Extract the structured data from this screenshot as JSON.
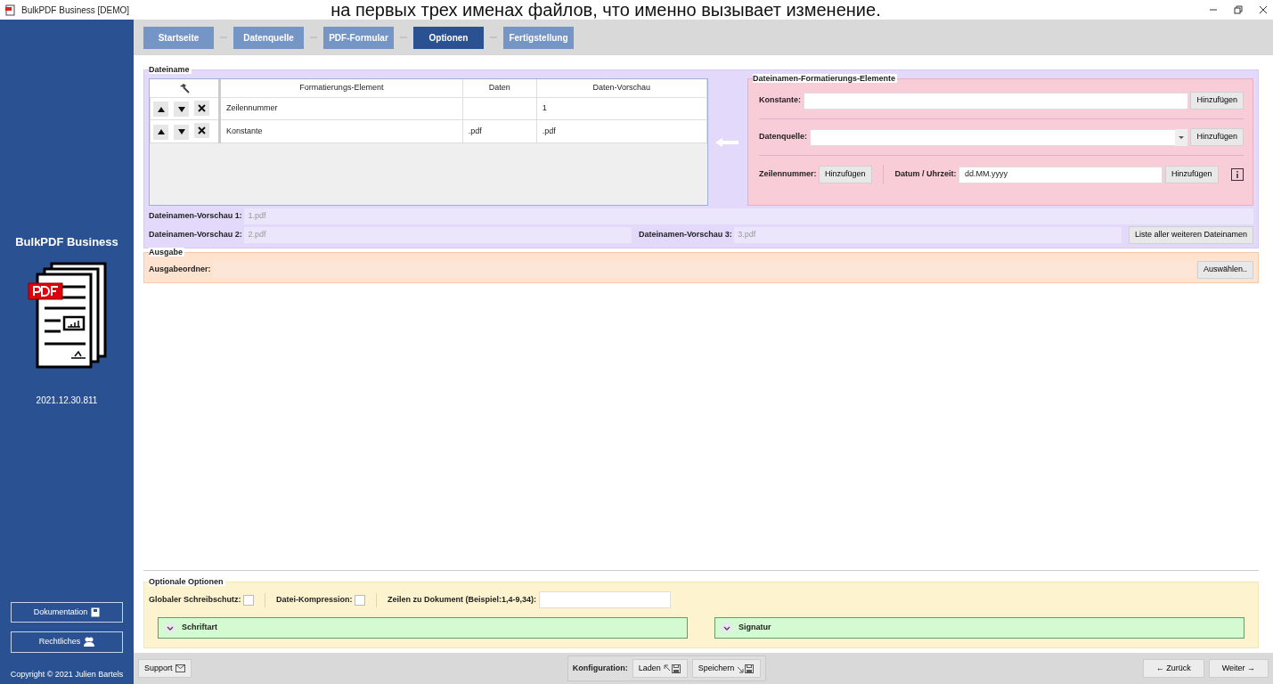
{
  "overlay_caption": "на первых трех именах файлов, что именно вызывает изменение.",
  "window": {
    "title": "BulkPDF Business [DEMO]"
  },
  "sidebar": {
    "app_name": "BulkPDF Business",
    "version": "2021.12.30.811",
    "buttons": [
      "Dokumentation",
      "Rechtliches"
    ],
    "copyright": "Copyright © 2021 Julien Bartels"
  },
  "steps": [
    {
      "label": "Startseite",
      "selected": false
    },
    {
      "label": "Datenquelle",
      "selected": false
    },
    {
      "label": "PDF-Formular",
      "selected": false
    },
    {
      "label": "Optionen",
      "selected": true
    },
    {
      "label": "Fertigstellung",
      "selected": false
    }
  ],
  "dateiname": {
    "title": "Dateiname",
    "table": {
      "columns": [
        "Formatierungs-Element",
        "Daten",
        "Daten-Vorschau"
      ],
      "rows": [
        [
          "Zeilennummer",
          "",
          "1"
        ],
        [
          "Konstante",
          ".pdf",
          ".pdf"
        ]
      ]
    },
    "elements": {
      "title": "Dateinamen-Formatierungs-Elemente",
      "konstante_label": "Konstante:",
      "datenquelle_label": "Datenquelle:",
      "zeilennummer_label": "Zeilennummer:",
      "datum_label": "Datum / Uhrzeit:",
      "datum_value": "dd.MM.yyyy",
      "konstante_button": "Hinzufügen",
      "datenquelle_button": "Hinzufügen",
      "zeilennummer_button": "Hinzufügen",
      "datum_button": "Hinzufügen"
    },
    "previews": [
      {
        "label": "Dateinamen-Vorschau 1:",
        "value": "1.pdf"
      },
      {
        "label": "Dateinamen-Vorschau 2:",
        "value": "2.pdf"
      },
      {
        "label": "Dateinamen-Vorschau 3:",
        "value": "3.pdf"
      }
    ],
    "list_button": "Liste aller weiteren Dateinamen"
  },
  "ausgabe": {
    "title": "Ausgabe",
    "label": "Ausgabeordner:",
    "button": "Auswählen.."
  },
  "optionale": {
    "title": "Optionale Optionen",
    "checks": [
      {
        "label": "Globaler Schreibschutz:",
        "checked": false
      },
      {
        "label": "Datei-Kompression:",
        "checked": false
      }
    ],
    "zeilen_label": "Zeilen zu Dokument (Beispiel:1,4-9,34):",
    "expanders": [
      {
        "label": "Schriftart",
        "expanded": false
      },
      {
        "label": "Signatur",
        "expanded": false
      }
    ]
  },
  "footer": {
    "support": "Support",
    "konfiguration_label": "Konfiguration:",
    "laden": "Laden",
    "speichern": "Speichern",
    "zurueck": "← Zurück",
    "weiter": "Weiter →"
  }
}
